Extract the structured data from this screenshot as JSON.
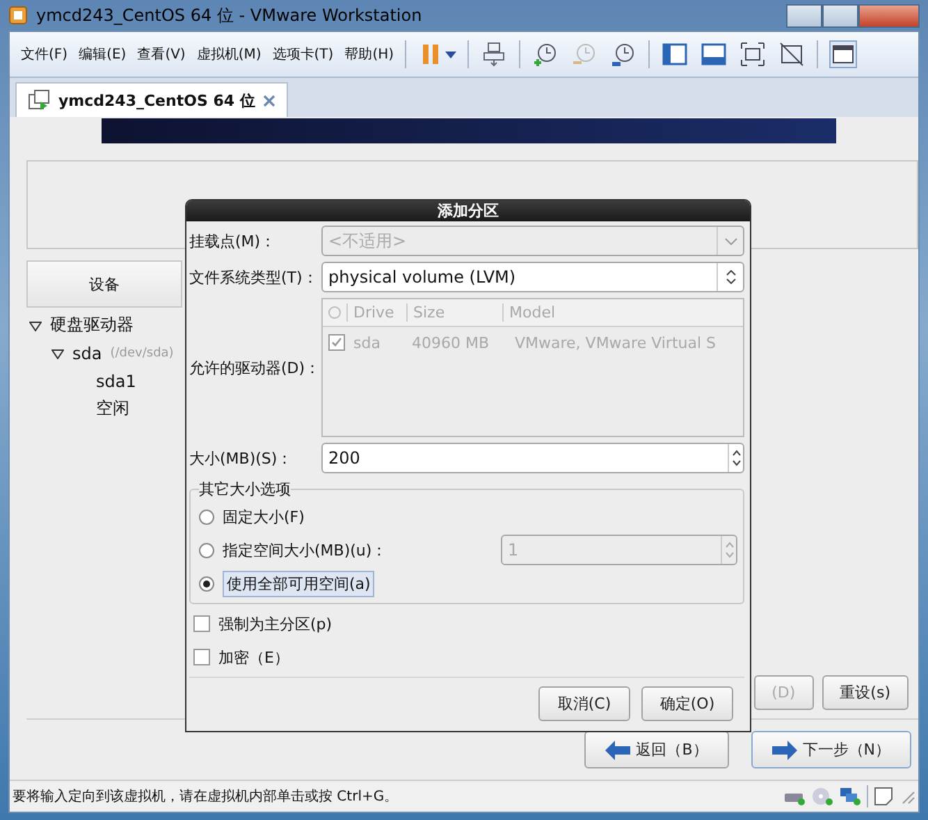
{
  "window": {
    "title": "ymcd243_CentOS 64 位 - VMware Workstation"
  },
  "menu": [
    "文件(F)",
    "编辑(E)",
    "查看(V)",
    "虚拟机(M)",
    "选项卡(T)",
    "帮助(H)"
  ],
  "tabs": [
    {
      "label": "ymcd243_CentOS 64 位",
      "selected": true
    }
  ],
  "installer": {
    "device_column": "设备",
    "tree": [
      {
        "label": "硬盘驱动器",
        "expanded": true,
        "children": [
          {
            "label": "sda",
            "note": "(/dev/sda)",
            "expanded": true,
            "children": [
              {
                "label": "sda1"
              },
              {
                "label": "空闲"
              }
            ]
          }
        ]
      }
    ],
    "buttons": [
      {
        "label": "(D)",
        "disabled": true
      },
      {
        "label": "重设(s)",
        "disabled": false
      }
    ],
    "nav": [
      {
        "label": "返回（B）",
        "kind": "back"
      },
      {
        "label": "下一步（N）",
        "kind": "next"
      }
    ]
  },
  "dialog": {
    "title": "添加分区",
    "mount_point": {
      "label": "挂载点(M)：",
      "value": "<不适用>",
      "disabled": true
    },
    "fs_type": {
      "label": "文件系统类型(T)：",
      "value": "physical volume (LVM)"
    },
    "drives": {
      "label": "允许的驱动器(D)：",
      "columns": [
        "Drive",
        "Size",
        "Model"
      ],
      "rows": [
        {
          "checked": true,
          "drive": "sda",
          "size": "40960 MB",
          "model": "VMware, VMware Virtual S"
        }
      ]
    },
    "size": {
      "label": "大小(MB)(S)：",
      "value": "200"
    },
    "size_options": {
      "title": "其它大小选项",
      "options": [
        {
          "label": "固定大小(F)",
          "selected": false
        },
        {
          "label": "指定空间大小(MB)(u)：",
          "selected": false
        },
        {
          "label": "使用全部可用空间(a)",
          "selected": true
        }
      ],
      "max_value": "1"
    },
    "checks": [
      {
        "label": "强制为主分区(p)",
        "checked": false
      },
      {
        "label": "加密（E）",
        "checked": false
      }
    ],
    "buttons": [
      "取消(C)",
      "确定(O)"
    ]
  },
  "status_bar": "要将输入定向到该虚拟机，请在虚拟机内部单击或按 Ctrl+G。"
}
